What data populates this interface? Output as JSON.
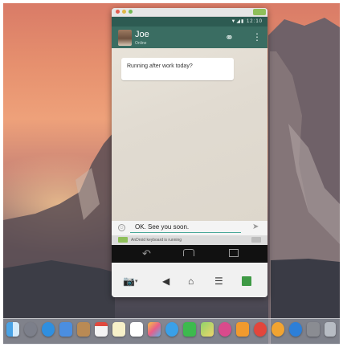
{
  "emulator": {
    "status_time": "▼◢▮ 12:10"
  },
  "chat": {
    "contact_name": "Joe",
    "contact_status": "Online",
    "messages": [
      {
        "text": "Running after work today?",
        "time": ""
      }
    ],
    "input_value": "OK. See you soon.",
    "keyboard_notice": "AnDroid keyboard is running"
  },
  "icons": {
    "attach": "paperclip-icon",
    "more": "overflow-menu-icon",
    "send": "send-icon",
    "emoji": "smiley-icon"
  },
  "colors": {
    "appbar": "#3a6d62",
    "statusbar": "#2d5b52",
    "input_underline": "#4aa99a"
  },
  "dock": {
    "icons": [
      "finder",
      "launchpad",
      "safari",
      "mail",
      "contacts",
      "calendar",
      "notes",
      "reminders",
      "photos",
      "messages",
      "facetime",
      "maps",
      "itunes",
      "ibooks",
      "app-store",
      "system-preferences",
      "chrome",
      "android-emulator"
    ]
  }
}
